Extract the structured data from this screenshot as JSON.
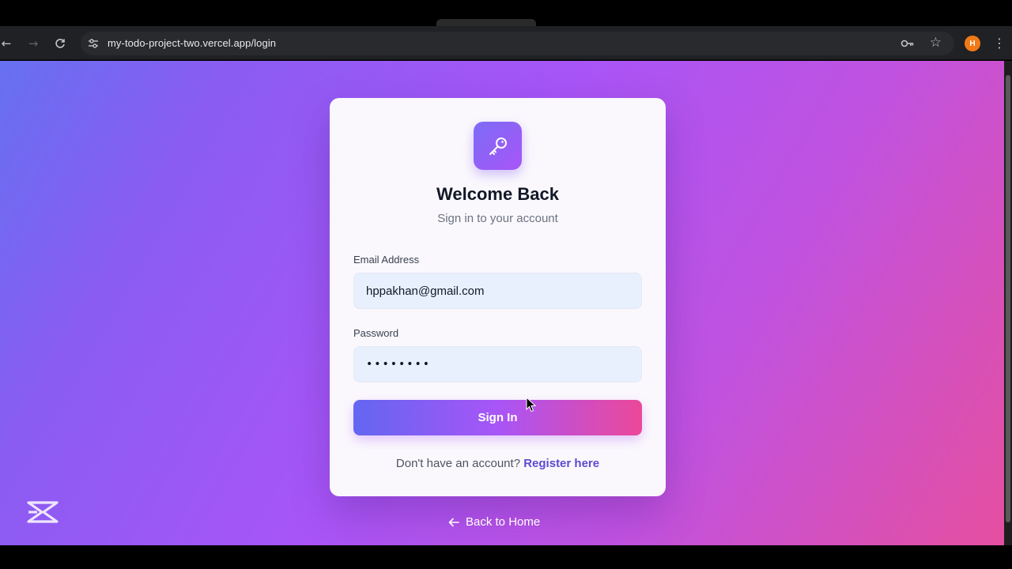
{
  "browser": {
    "url": "my-todo-project-two.vercel.app/login",
    "profile_initial": "H",
    "profile_color": "#f07a16",
    "icons": [
      "back-arrow-icon",
      "forward-arrow-icon",
      "reload-icon",
      "site-info-icon",
      "password-key-icon",
      "bookmark-star-icon",
      "more-menu-icon"
    ]
  },
  "login": {
    "title": "Welcome Back",
    "subtitle": "Sign in to your account",
    "email_label": "Email Address",
    "email_value": "hppakhan@gmail.com",
    "password_label": "Password",
    "password_value": "••••••••",
    "sign_in_label": "Sign In",
    "no_account_text": "Don't have an account?",
    "register_link": "Register here",
    "logo_icon": "key-icon"
  },
  "footer": {
    "back_home_label": "Back to Home",
    "back_icon": "arrow-left-icon"
  },
  "colors": {
    "accent": "#a855f7",
    "link": "#5b4bd1",
    "gradient_start": "#6366f1",
    "gradient_end": "#ec4899"
  }
}
